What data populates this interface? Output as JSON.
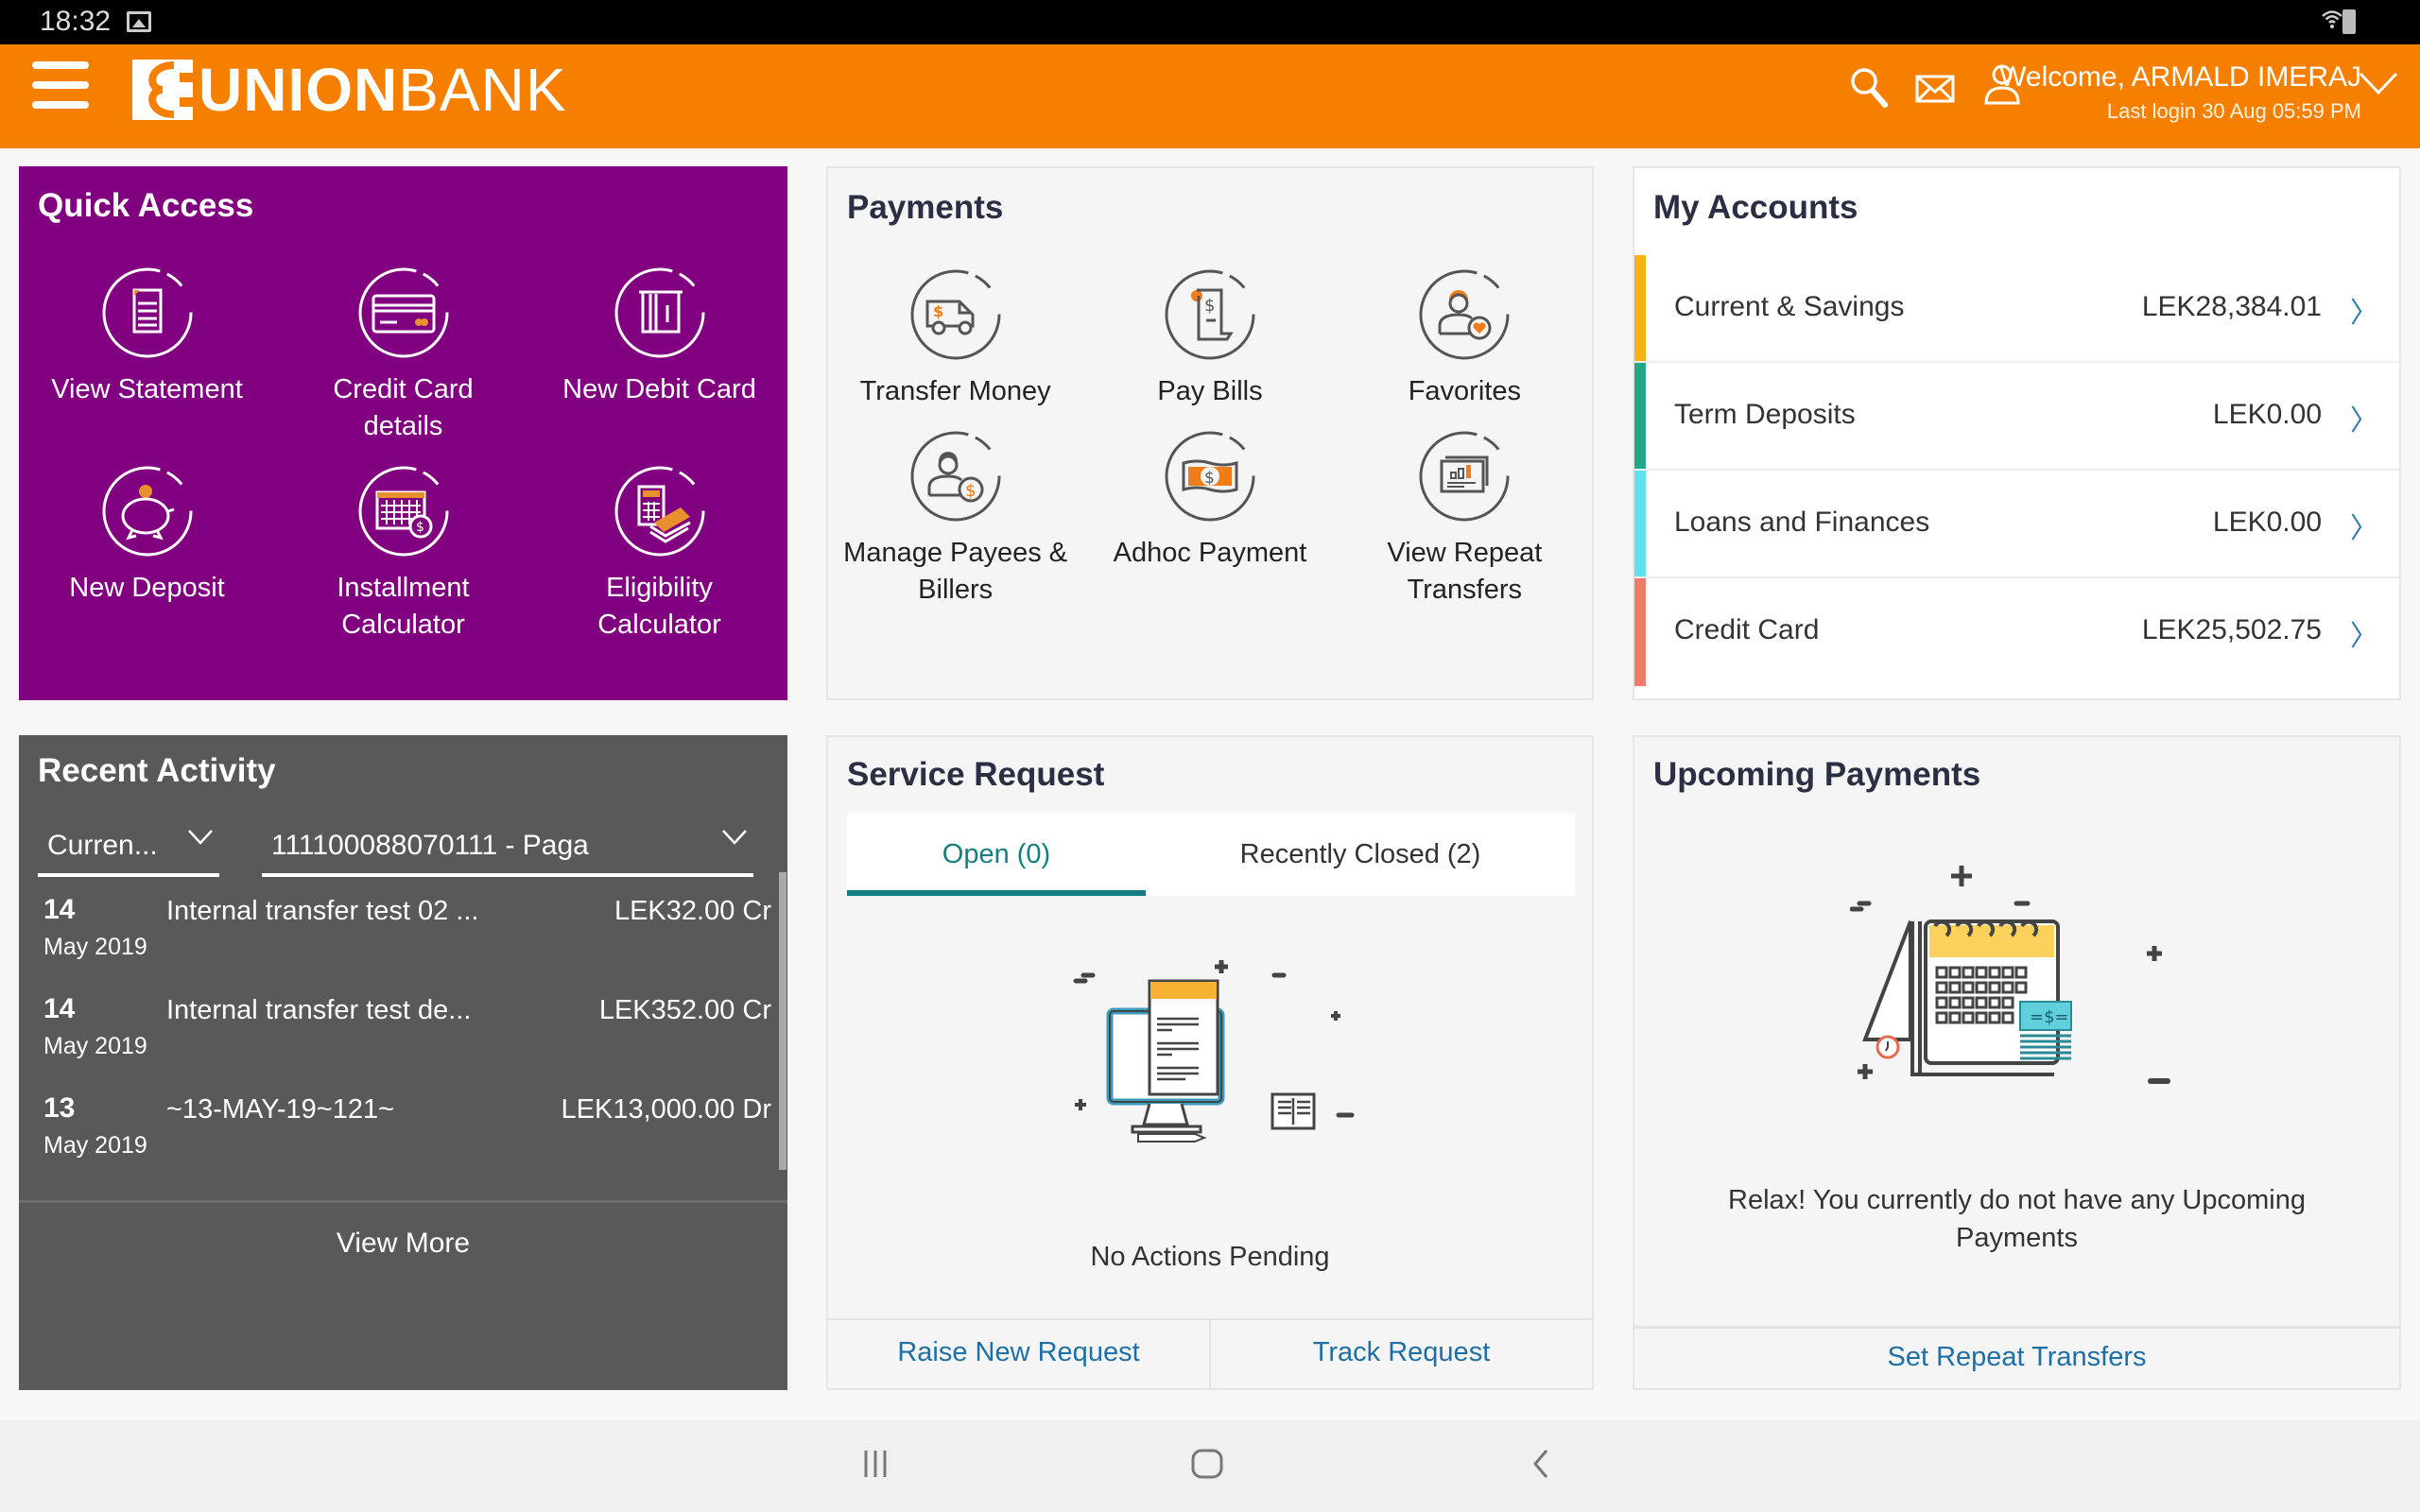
{
  "status_bar": {
    "time": "18:32"
  },
  "header": {
    "brand_bold": "UNION",
    "brand_light": "BANK",
    "welcome": "Welcome, ARMALD IMERAJ",
    "last_login": "Last login 30 Aug 05:59 PM",
    "brand_color": "#f77f00"
  },
  "quick_access": {
    "title": "Quick Access",
    "bg_color": "#800080",
    "items": [
      {
        "label": "View Statement",
        "icon": "document-icon"
      },
      {
        "label": "Credit Card details",
        "icon": "credit-card-icon"
      },
      {
        "label": "New Debit Card",
        "icon": "debit-card-icon"
      },
      {
        "label": "New Deposit",
        "icon": "piggy-bank-icon"
      },
      {
        "label": "Installment Calculator",
        "icon": "calendar-dollar-icon"
      },
      {
        "label": "Eligibility Calculator",
        "icon": "calculator-icon"
      }
    ]
  },
  "payments": {
    "title": "Payments",
    "items": [
      {
        "label": "Transfer Money",
        "icon": "van-dollar-icon"
      },
      {
        "label": "Pay Bills",
        "icon": "bill-icon"
      },
      {
        "label": "Favorites",
        "icon": "user-heart-icon"
      },
      {
        "label": "Manage Payees & Billers",
        "icon": "user-dollar-icon"
      },
      {
        "label": "Adhoc Payment",
        "icon": "banknote-icon"
      },
      {
        "label": "View Repeat Transfers",
        "icon": "report-icon"
      }
    ]
  },
  "my_accounts": {
    "title": "My Accounts",
    "rows": [
      {
        "name": "Current & Savings",
        "amount": "LEK28,384.01",
        "color": "#f5b316"
      },
      {
        "name": "Term Deposits",
        "amount": "LEK0.00",
        "color": "#1fa88a"
      },
      {
        "name": "Loans and Finances",
        "amount": "LEK0.00",
        "color": "#5ce3ec"
      },
      {
        "name": "Credit Card",
        "amount": "LEK25,502.75",
        "color": "#f27a6a"
      }
    ]
  },
  "recent_activity": {
    "title": "Recent Activity",
    "account_type": "Curren...",
    "account_number": "111100088070111 - Paga",
    "rows": [
      {
        "day": "14",
        "month_year": "May 2019",
        "description": "Internal transfer test 02 ...",
        "amount": "LEK32.00 Cr"
      },
      {
        "day": "14",
        "month_year": "May 2019",
        "description": "Internal transfer test de...",
        "amount": "LEK352.00 Cr"
      },
      {
        "day": "13",
        "month_year": "May 2019",
        "description": "~13-MAY-19~121~",
        "amount": "LEK13,000.00 Dr"
      }
    ],
    "view_more": "View More"
  },
  "service_request": {
    "title": "Service Request",
    "tabs": [
      {
        "label": "Open (0)",
        "active": true
      },
      {
        "label": "Recently Closed (2)",
        "active": false
      }
    ],
    "empty_message": "No Actions Pending",
    "links": [
      "Raise New Request",
      "Track Request"
    ],
    "accent_color": "#137f80"
  },
  "upcoming_payments": {
    "title": "Upcoming Payments",
    "empty_message": "Relax! You currently do not have any Upcoming Payments",
    "link": "Set Repeat Transfers"
  }
}
